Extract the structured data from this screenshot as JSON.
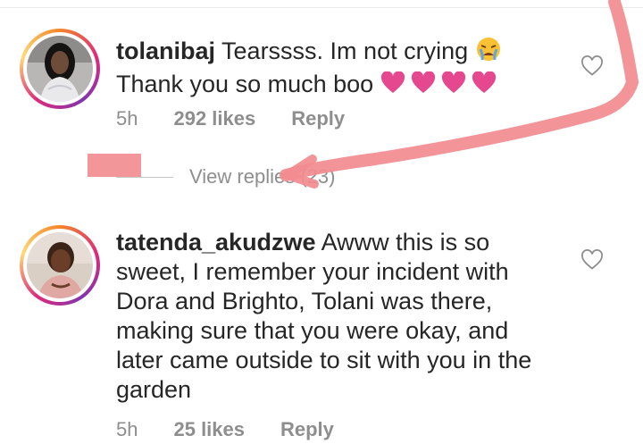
{
  "comments": [
    {
      "username": "tolanibaj",
      "text_line1": "Tearssss. Im not crying",
      "emoji_line1": "crying-face-emoji",
      "text_line2": "Thank you so much boo",
      "hearts_line2": [
        "pink-heart-emoji",
        "pink-heart-emoji",
        "pink-heart-emoji",
        "pink-heart-emoji"
      ],
      "time": "5h",
      "likes": "292 likes",
      "reply": "Reply"
    },
    {
      "username": "tatenda_akudzwe",
      "text_lines": [
        "Awww this is so",
        "sweet, I remember your incident with",
        "Dora and Brighto, Tolani was there,",
        "making sure that you were okay, and",
        "later came outside to sit with you in the",
        "garden"
      ],
      "time": "5h",
      "likes": "25 likes",
      "reply": "Reply"
    }
  ],
  "view_replies": "View replies (23)",
  "colors": {
    "annotation": "#f28b8f",
    "heart": "#e5488f",
    "meta_text": "#8e8e8e"
  }
}
